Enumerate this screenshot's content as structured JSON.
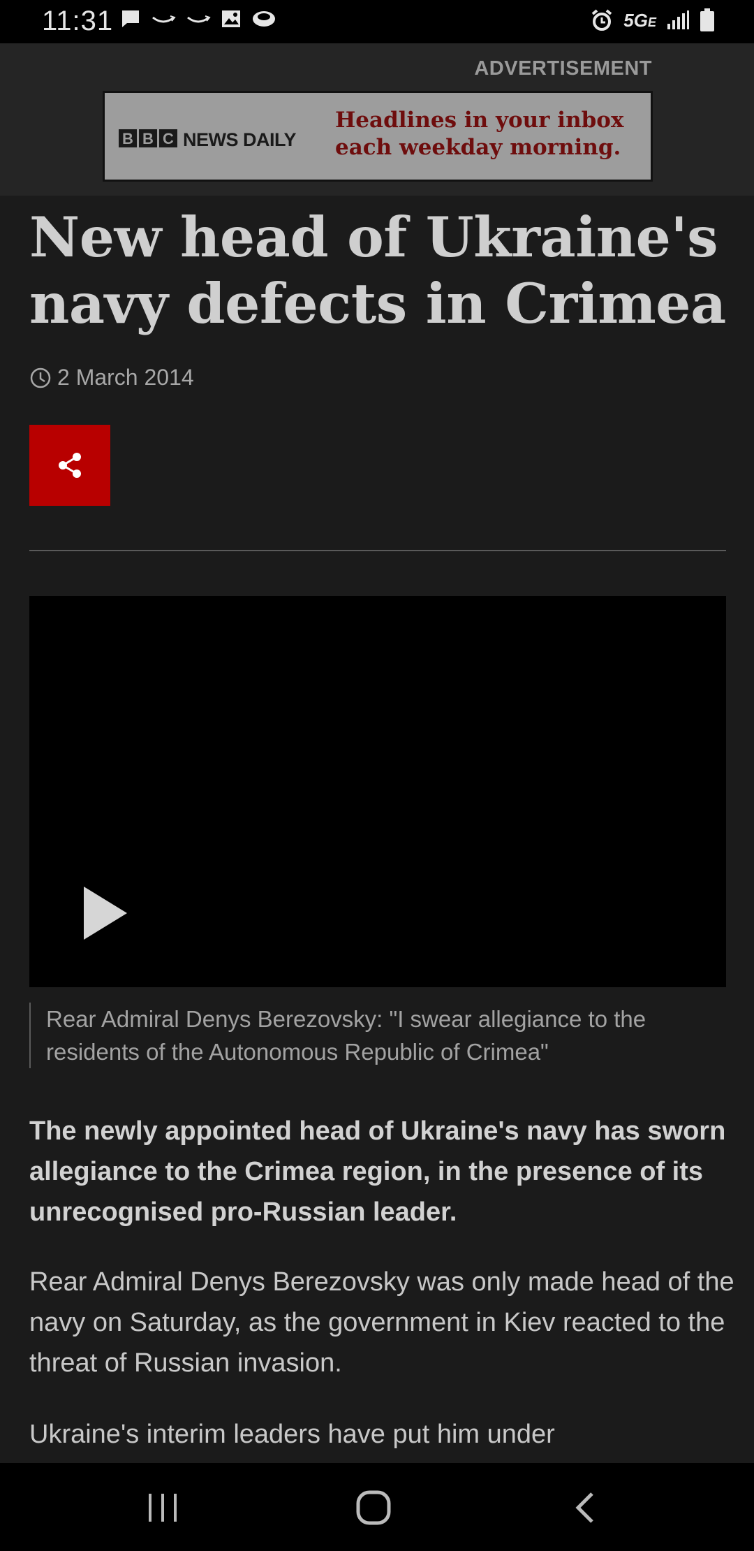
{
  "status_bar": {
    "time": "11:31",
    "network": "5G",
    "network_sub": "E",
    "left_icons": [
      "message-icon",
      "amazon-icon",
      "amazon-icon",
      "gallery-icon",
      "app-icon"
    ],
    "right_icons": [
      "alarm-icon",
      "signal-icon",
      "battery-icon"
    ]
  },
  "ad": {
    "label": "ADVERTISEMENT",
    "brand_letters": [
      "B",
      "B",
      "C"
    ],
    "brand_name": "NEWS DAILY",
    "headline": "Headlines in your inbox each weekday morning."
  },
  "article": {
    "headline": "New head of Ukraine's navy defects in Crimea",
    "date": "2 March 2014",
    "share_icon": "share-icon",
    "video_caption": "Rear Admiral Denys Berezovsky: \"I swear allegiance to the residents of the Autonomous Republic of Crimea\"",
    "intro": "The newly appointed head of Ukraine's navy has sworn allegiance to the Crimea region, in the presence of its unrecognised pro-Russian leader.",
    "paragraphs": [
      "Rear Admiral Denys Berezovsky was only made head of the navy on Saturday, as the government in Kiev reacted to the threat of Russian invasion.",
      "Ukraine's interim leaders have put him under"
    ]
  },
  "colors": {
    "background": "#1b1b1b",
    "share_button": "#b80000",
    "ad_headline": "#6e0d0d"
  }
}
